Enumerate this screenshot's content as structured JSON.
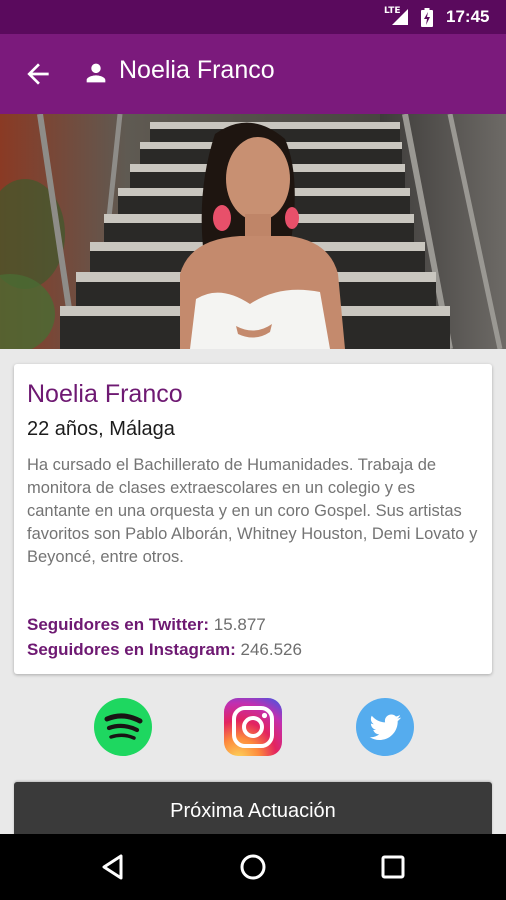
{
  "status_bar": {
    "network": "LTE",
    "time": "17:45"
  },
  "app_bar": {
    "title": "Noelia Franco",
    "back_icon": "arrow-back-icon",
    "person_icon": "person-icon"
  },
  "hero": {
    "image": "photo of Noelia Franco in white top in front of staircase"
  },
  "profile": {
    "name": "Noelia Franco",
    "age_city": "22 años, Málaga",
    "bio": "Ha cursado el Bachillerato de Humanidades. Trabaja de monitora de clases extraescolares en un colegio y es cantante en una orquesta y en un coro Gospel. Sus artistas favoritos son Pablo Alborán, Whitney Houston, Demi Lovato y Beyoncé, entre otros.",
    "twitter_label": "Seguidores en Twitter:",
    "twitter_value": "15.877",
    "instagram_label": "Seguidores en Instagram:",
    "instagram_value": "246.526"
  },
  "social": {
    "spotify": {
      "icon": "spotify-icon",
      "color": "#1ed760"
    },
    "instagram": {
      "icon": "instagram-icon",
      "color": "#c13584"
    },
    "twitter": {
      "icon": "twitter-icon",
      "color": "#55acee"
    }
  },
  "next_button": {
    "label": "Próxima Actuación"
  },
  "nav_bar": {
    "back": "nav-back-icon",
    "home": "nav-home-icon",
    "recents": "nav-recents-icon"
  },
  "colors": {
    "primary": "#7b1a7c",
    "primary_dark": "#5a0a5d",
    "accent_text": "#6e1972"
  }
}
